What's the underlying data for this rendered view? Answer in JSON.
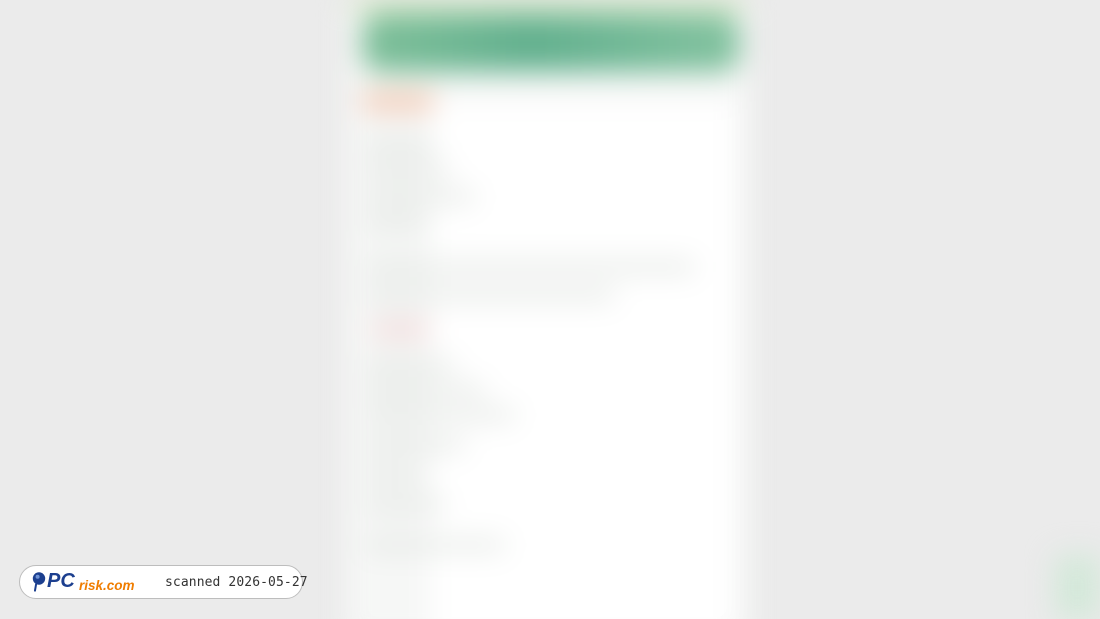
{
  "watermark": {
    "logo_text": "PCrisk.com",
    "scan_text": "scanned 2026-05-27"
  },
  "colors": {
    "background": "#ebebeb",
    "banner_green": "#62b08e",
    "logo_blue": "#1c3f8f",
    "logo_orange": "#f07d00"
  }
}
